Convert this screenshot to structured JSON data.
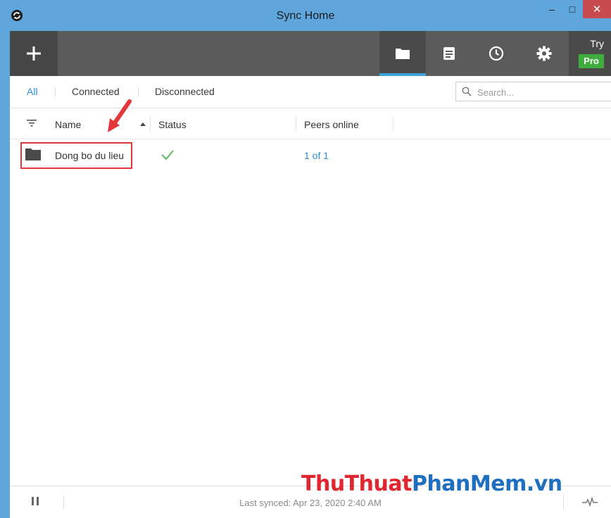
{
  "window": {
    "title": "Sync Home",
    "minimize": "–",
    "maximize": "□",
    "close": "✕"
  },
  "toolbar": {
    "add_icon": "plus-icon",
    "tabs": [
      {
        "icon": "folder-icon",
        "active": true
      },
      {
        "icon": "log-icon",
        "active": false
      },
      {
        "icon": "history-clock-icon",
        "active": false
      },
      {
        "icon": "gear-icon",
        "active": false
      }
    ],
    "try_label": "Try",
    "pro_label": "Pro"
  },
  "filters": {
    "all": "All",
    "connected": "Connected",
    "disconnected": "Disconnected",
    "active": "All"
  },
  "search": {
    "placeholder": "Search...",
    "value": ""
  },
  "columns": {
    "name": "Name",
    "status": "Status",
    "peers": "Peers online"
  },
  "folders": [
    {
      "name": "Dong bo du lieu",
      "status": "synced",
      "peers": "1 of 1"
    }
  ],
  "statusbar": {
    "last_synced": "Last synced: Apr 23, 2020 2:40 AM"
  },
  "watermark": {
    "part1": "ThuThuat",
    "part2": "PhanMem.vn"
  },
  "colors": {
    "accent": "#2f8fd1",
    "toolbar": "#5b5b5b",
    "pro_badge": "#3fae3f",
    "highlight": "#e2363a",
    "check": "#5cb85c"
  }
}
